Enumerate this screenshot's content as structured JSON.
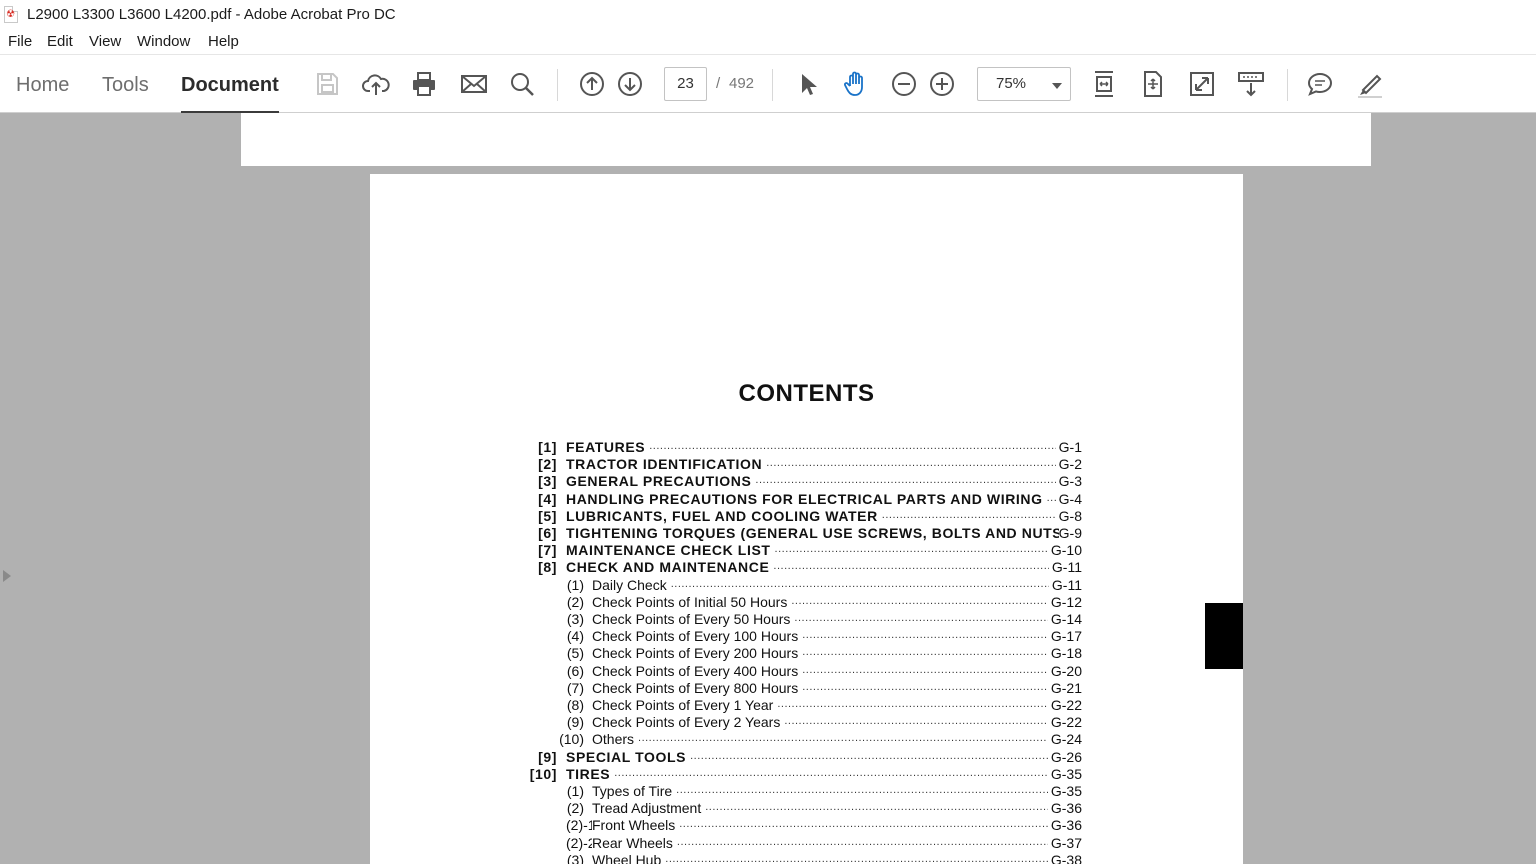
{
  "window": {
    "title": "L2900 L3300 L3600 L4200.pdf - Adobe Acrobat Pro DC"
  },
  "menu": {
    "items": [
      "File",
      "Edit",
      "View",
      "Window",
      "Help"
    ]
  },
  "nav": {
    "home": "Home",
    "tools": "Tools",
    "document": "Document"
  },
  "toolbar": {
    "current_page": "23",
    "page_separator": "/",
    "total_pages": "492",
    "zoom": "75%",
    "icons": [
      "save-icon",
      "cloud-upload-icon",
      "print-icon",
      "email-icon",
      "search-icon",
      "previous-page-icon",
      "next-page-icon",
      "select-cursor-icon",
      "hand-tool-icon",
      "zoom-out-icon",
      "zoom-in-icon",
      "scroll-mode-icon",
      "fit-page-icon",
      "full-screen-icon",
      "read-mode-icon",
      "comment-icon",
      "highlight-pen-icon"
    ]
  },
  "document": {
    "heading": "CONTENTS",
    "toc": [
      {
        "num": "[1]",
        "label": "FEATURES",
        "page": "G-1",
        "level": 1
      },
      {
        "num": "[2]",
        "label": "TRACTOR IDENTIFICATION",
        "page": "G-2",
        "level": 1
      },
      {
        "num": "[3]",
        "label": "GENERAL PRECAUTIONS",
        "page": "G-3",
        "level": 1
      },
      {
        "num": "[4]",
        "label": "HANDLING PRECAUTIONS FOR ELECTRICAL PARTS AND WIRING",
        "page": "G-4",
        "level": 1
      },
      {
        "num": "[5]",
        "label": "LUBRICANTS, FUEL AND COOLING WATER",
        "page": "G-8",
        "level": 1
      },
      {
        "num": "[6]",
        "label": "TIGHTENING TORQUES (GENERAL USE SCREWS, BOLTS AND NUTS)",
        "page": "G-9",
        "level": 1
      },
      {
        "num": "[7]",
        "label": "MAINTENANCE CHECK LIST",
        "page": "G-10",
        "level": 1
      },
      {
        "num": "[8]",
        "label": "CHECK AND MAINTENANCE",
        "page": "G-11",
        "level": 1
      },
      {
        "num": "(1)",
        "label": "Daily Check",
        "page": "G-11",
        "level": 2
      },
      {
        "num": "(2)",
        "label": "Check Points of Initial 50 Hours",
        "page": "G-12",
        "level": 2
      },
      {
        "num": "(3)",
        "label": "Check Points of Every 50 Hours",
        "page": "G-14",
        "level": 2
      },
      {
        "num": "(4)",
        "label": "Check Points of Every 100 Hours",
        "page": "G-17",
        "level": 2
      },
      {
        "num": "(5)",
        "label": "Check Points of Every 200 Hours",
        "page": "G-18",
        "level": 2
      },
      {
        "num": "(6)",
        "label": "Check Points of Every 400 Hours",
        "page": "G-20",
        "level": 2
      },
      {
        "num": "(7)",
        "label": "Check Points of Every 800 Hours",
        "page": "G-21",
        "level": 2
      },
      {
        "num": "(8)",
        "label": "Check Points of Every 1 Year",
        "page": "G-22",
        "level": 2
      },
      {
        "num": "(9)",
        "label": "Check Points of Every 2 Years",
        "page": "G-22",
        "level": 2
      },
      {
        "num": "(10)",
        "label": "Others",
        "page": "G-24",
        "level": 2
      },
      {
        "num": "[9]",
        "label": "SPECIAL TOOLS",
        "page": "G-26",
        "level": 1
      },
      {
        "num": "[10]",
        "label": "TIRES",
        "page": "G-35",
        "level": 1
      },
      {
        "num": "(1)",
        "label": "Types of Tire",
        "page": "G-35",
        "level": 2
      },
      {
        "num": "(2)",
        "label": "Tread Adjustment",
        "page": "G-36",
        "level": 2
      },
      {
        "num": "(2)-1",
        "label": "Front Wheels",
        "page": "G-36",
        "level": 3
      },
      {
        "num": "(2)-2",
        "label": "Rear Wheels",
        "page": "G-37",
        "level": 3
      },
      {
        "num": "(3)",
        "label": "Wheel Hub",
        "page": "G-38",
        "level": 2
      }
    ]
  }
}
